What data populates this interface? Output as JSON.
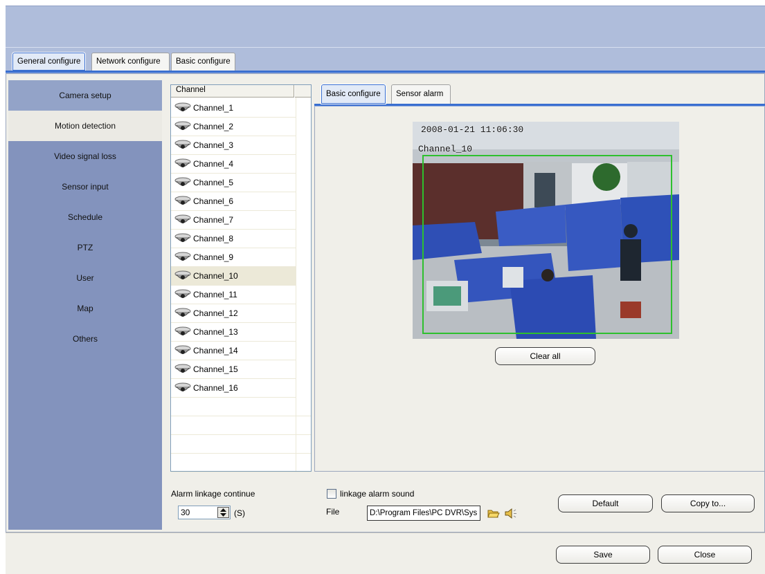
{
  "top_tabs": [
    "General configure",
    "Network configure",
    "Basic configure"
  ],
  "sidebar": {
    "items": [
      {
        "label": "Camera setup"
      },
      {
        "label": "Motion detection"
      },
      {
        "label": "Video signal loss"
      },
      {
        "label": "Sensor input"
      },
      {
        "label": "Schedule"
      },
      {
        "label": "PTZ"
      },
      {
        "label": "User"
      },
      {
        "label": "Map"
      },
      {
        "label": "Others"
      }
    ],
    "selected": "Motion detection"
  },
  "channel_list": {
    "header": "Channel",
    "selected": "Channel_10",
    "items": [
      "Channel_1",
      "Channel_2",
      "Channel_3",
      "Channel_4",
      "Channel_5",
      "Channel_6",
      "Channel_7",
      "Channel_8",
      "Channel_9",
      "Channel_10",
      "Channel_11",
      "Channel_12",
      "Channel_13",
      "Channel_14",
      "Channel_15",
      "Channel_16"
    ]
  },
  "inner_tabs": [
    "Basic configure",
    "Sensor alarm"
  ],
  "video": {
    "timestamp": "2008-01-21 11:06:30",
    "channel_overlay": "Channel_10"
  },
  "buttons": {
    "clear_all": "Clear all",
    "default": "Default",
    "copy_to": "Copy to...",
    "save": "Save",
    "close": "Close"
  },
  "alarm": {
    "linkage_label": "Alarm linkage continue",
    "linkage_value": "30",
    "linkage_unit": "(S)",
    "sound_label": "linkage alarm sound",
    "sound_checked": false,
    "file_label": "File",
    "file_path": "D:\\Program Files\\PC DVR\\Sys"
  },
  "icons": {
    "channel": "dome-camera-icon",
    "open": "open-folder-icon",
    "speaker": "speaker-icon"
  },
  "colors": {
    "accent": "#3a6fd0",
    "sidebar": "#8393bd",
    "banner": "#afbddb",
    "motion_box": "#2ec02e"
  }
}
